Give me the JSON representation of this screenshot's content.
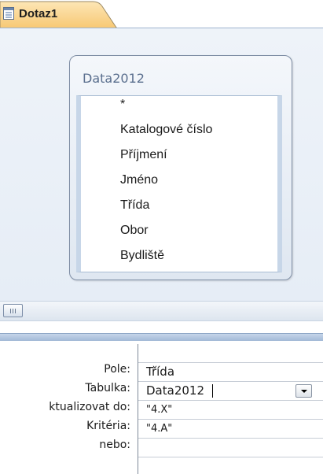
{
  "tab": {
    "title": "Dotaz1",
    "icon": "query-icon"
  },
  "table": {
    "name": "Data2012",
    "fields": [
      "*",
      "Katalogové číslo",
      "Příjmení",
      "Jméno",
      "Třída",
      "Obor",
      "Bydliště"
    ]
  },
  "grid": {
    "rows": {
      "pole": "Pole:",
      "tabulka": "Tabulka:",
      "aktualizovat": "ktualizovat do:",
      "kriteria": "Kritéria:",
      "nebo": "nebo:"
    },
    "values": {
      "pole": "Třída",
      "tabulka": "Data2012",
      "aktualizovat": "\"4.X\"",
      "kriteria": "\"4.A\"",
      "nebo": ""
    }
  },
  "colors": {
    "accent_tab": "#fbd38a",
    "border": "#9fb4cf"
  }
}
